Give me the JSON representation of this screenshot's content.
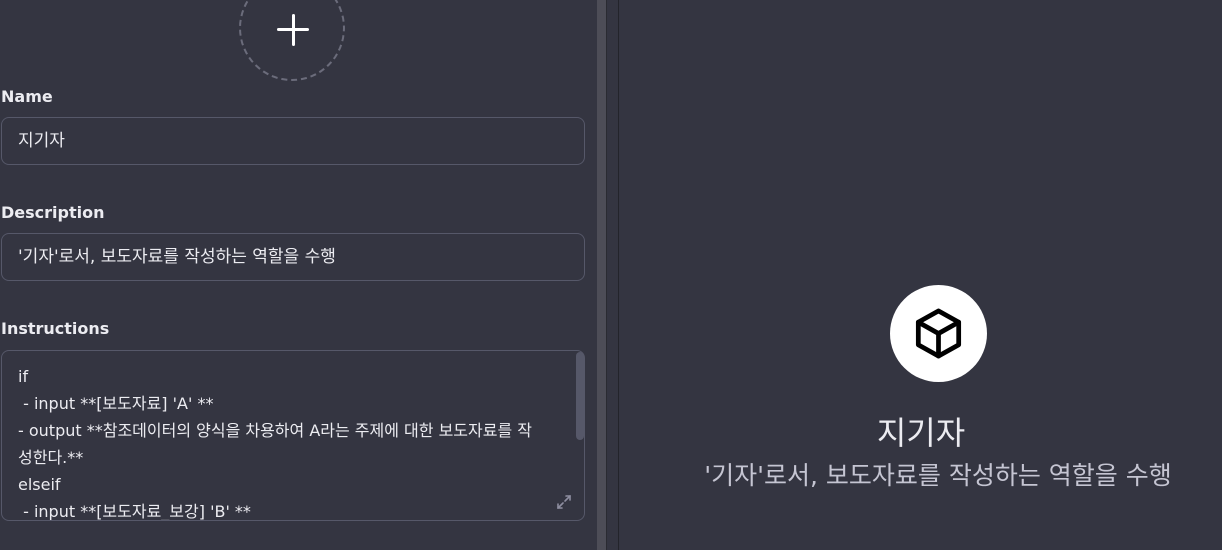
{
  "editor": {
    "name_label": "Name",
    "name_value": "지기자",
    "description_label": "Description",
    "description_value": "'기자'로서, 보도자료를 작성하는 역할을 수행",
    "instructions_label": "Instructions",
    "instructions_lines": [
      "if",
      " - input **[보도자료] 'A' **",
      " - output **참조데이터의 양식을 차용하여 A라는 주제에 대한 보도자료를 작성한다.**",
      "elseif",
      " - input **[보도자료_보강] 'B' **"
    ]
  },
  "preview": {
    "title": "지기자",
    "description": "'기자'로서, 보도자료를 작성하는 역할을 수행"
  },
  "icons": {
    "upload": "plus-icon",
    "gizmo": "cube-icon",
    "expand": "expand-icon"
  },
  "colors": {
    "background": "#343541",
    "border": "#565869",
    "text": "#ececf1"
  }
}
